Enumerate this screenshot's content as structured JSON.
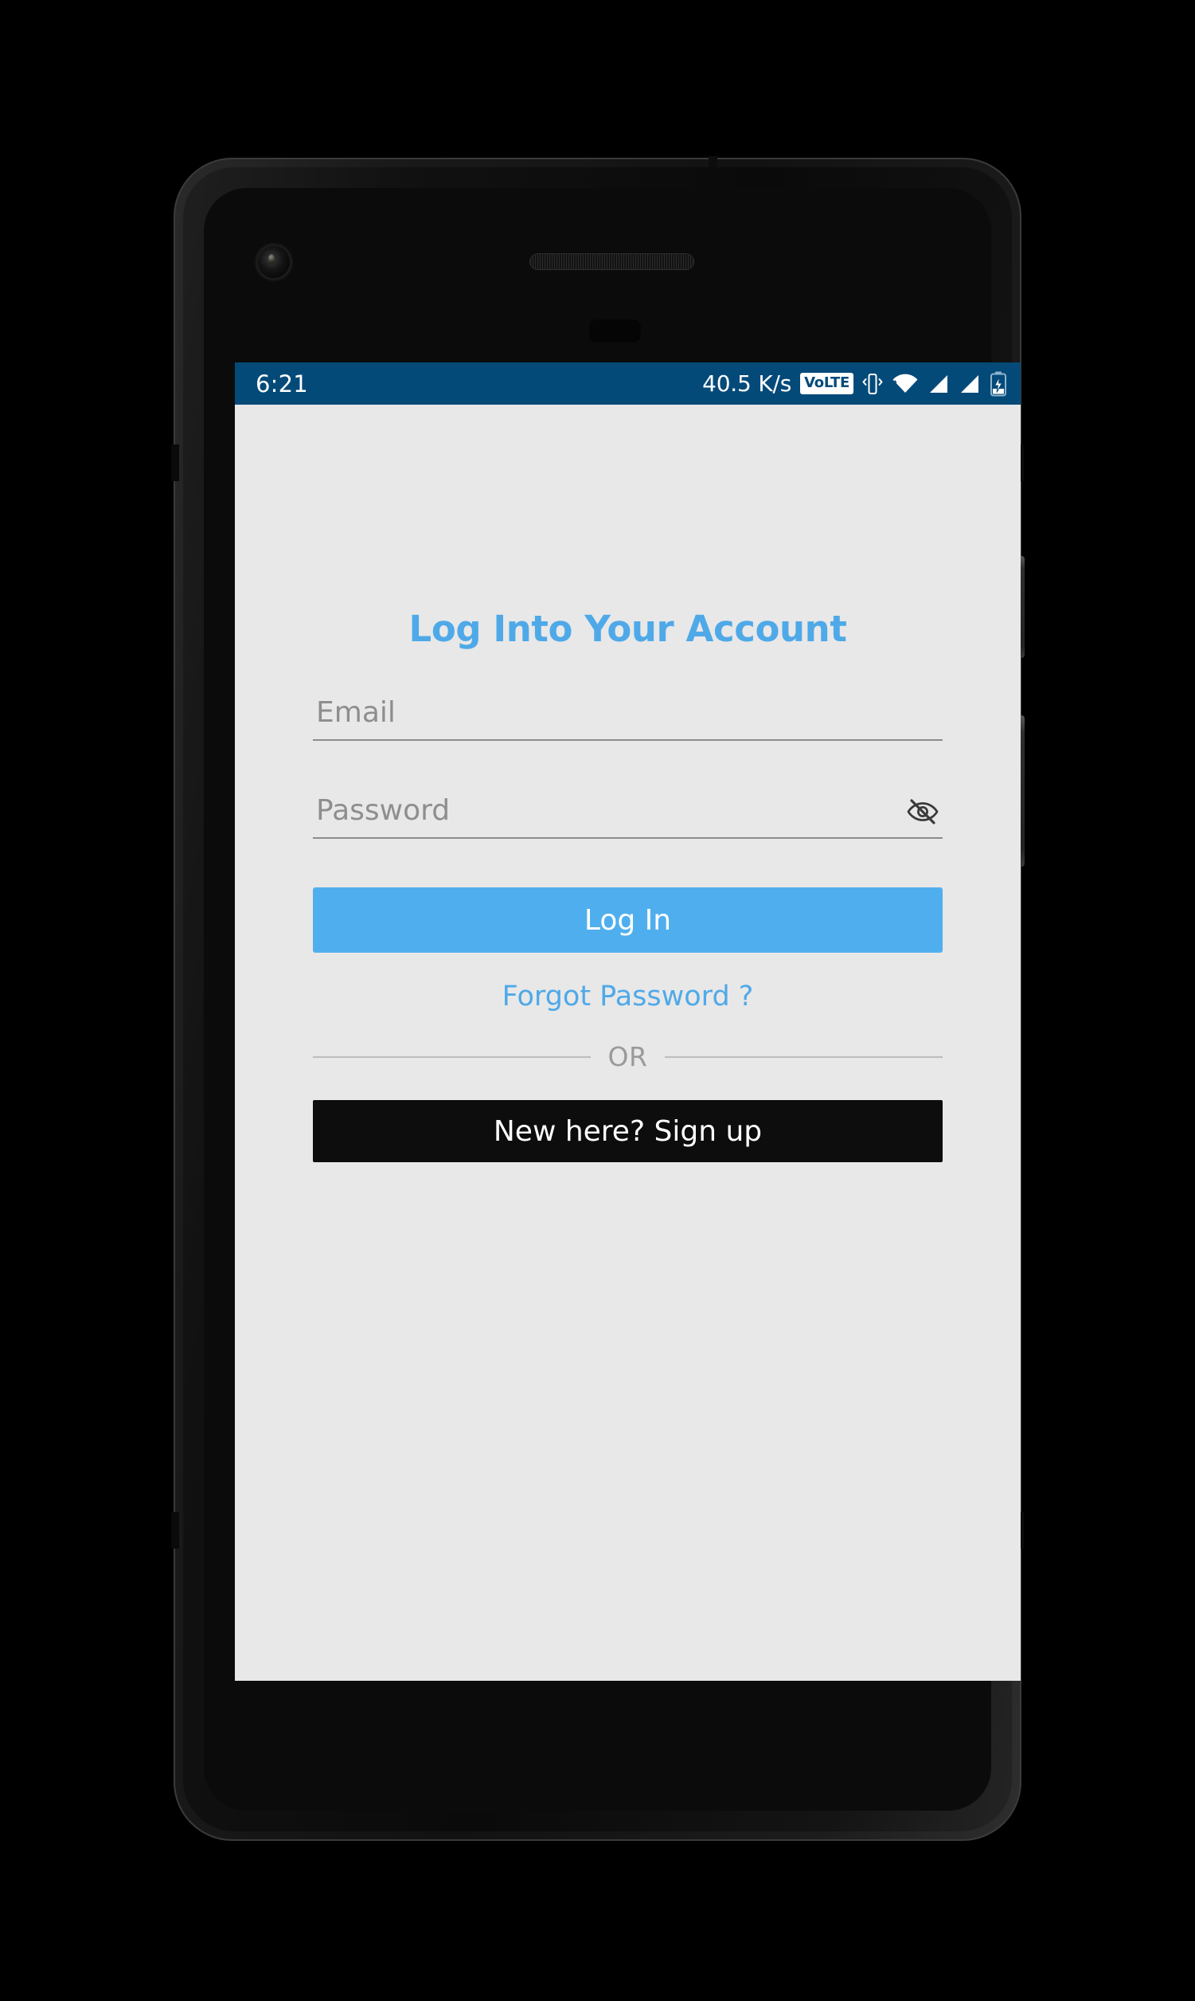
{
  "status_bar": {
    "time": "6:21",
    "network_speed": "40.5 K/s",
    "volte_label": "VoLTE",
    "icons": [
      "volte-badge-icon",
      "vibrate-icon",
      "wifi-icon",
      "signal-sim1-icon",
      "signal-sim2-icon",
      "battery-charging-icon"
    ],
    "background_color": "#044a79",
    "foreground_color": "#ffffff"
  },
  "screen": {
    "background_color": "#e8e8e8"
  },
  "login": {
    "title": "Log Into Your Account",
    "title_color": "#4fa9e8",
    "email": {
      "placeholder": "Email",
      "value": ""
    },
    "password": {
      "placeholder": "Password",
      "value": "",
      "visibility_icon": "eye-off-icon"
    },
    "login_button": {
      "label": "Log In",
      "background_color": "#4fafee",
      "text_color": "#ffffff"
    },
    "forgot_password_label": "Forgot Password ?",
    "divider_label": "OR",
    "signup_button": {
      "label": "New here? Sign up",
      "background_color": "#0d0d0d",
      "text_color": "#ffffff"
    }
  },
  "device": {
    "hardware": [
      "front-camera",
      "earpiece-speaker",
      "proximity-sensor",
      "power-button",
      "volume-button"
    ],
    "frame_color": "#1a1a1a"
  }
}
